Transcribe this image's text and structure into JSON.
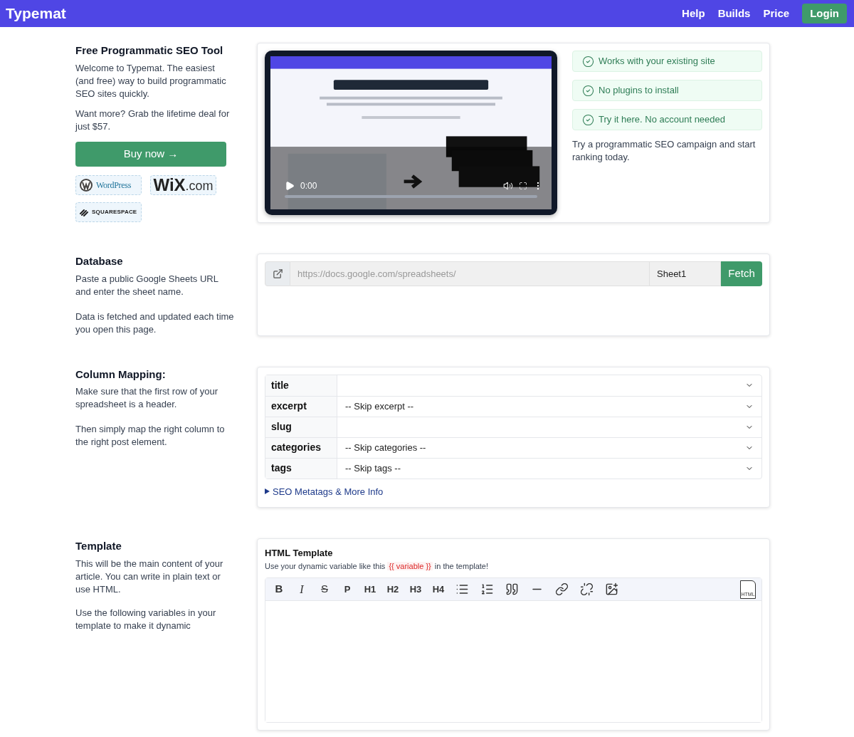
{
  "header": {
    "brand": "Typemat",
    "nav": [
      {
        "label": "Help",
        "kind": "link"
      },
      {
        "label": "Builds",
        "kind": "link"
      },
      {
        "label": "Price",
        "kind": "link"
      },
      {
        "label": "Login",
        "kind": "button"
      }
    ]
  },
  "intro": {
    "title": "Free Programmatic SEO Tool",
    "paragraphs": [
      "Welcome to Typemat. The easiest (and free) way to build programmatic SEO sites quickly.",
      "Want more? Grab the lifetime deal for just $57."
    ],
    "buy_button": "Buy now →",
    "logos": [
      {
        "kind": "wordpress",
        "text": "WordPress"
      },
      {
        "kind": "wix",
        "text": "WiX",
        "suffix": ".com"
      },
      {
        "kind": "squarespace",
        "text": "SQUARESPACE"
      }
    ],
    "video": {
      "kind": "picture",
      "time": "0:00"
    },
    "features": [
      "Works with your existing site",
      "No plugins to install",
      "Try it here. No account needed"
    ],
    "tagline": "Try a programmatic SEO campaign and start ranking today."
  },
  "database": {
    "title": "Database",
    "paragraphs": [
      "Paste a public Google Sheets URL and enter the sheet name.",
      "Data is fetched and updated each time you open this page."
    ],
    "url_placeholder": "https://docs.google.com/spreadsheets/",
    "sheet_value": "Sheet1",
    "fetch_button": "Fetch"
  },
  "mapping": {
    "title": "Column Mapping:",
    "paragraphs": [
      "Make sure that the first row of your spreadsheet is a header.",
      "Then simply map the right column to the right post element."
    ],
    "rows": [
      {
        "label": "title"
      },
      {
        "label": "excerpt",
        "value": "-- Skip excerpt --"
      },
      {
        "label": "slug"
      },
      {
        "label": "categories",
        "value": "-- Skip categories --"
      },
      {
        "label": "tags",
        "value": "-- Skip tags --"
      }
    ],
    "details": {
      "label": "SEO Metatags & More Info",
      "expanded": false
    }
  },
  "template": {
    "title": "Template",
    "paragraphs": [
      "This will be the main content of your article. You can write in plain text or use HTML.",
      "Use the following variables in your template to make it dynamic"
    ],
    "editor_title": "HTML Template",
    "hint_parts": [
      "Use your dynamic variable like this",
      "{{ variable }}",
      "in the template!"
    ],
    "text_buttons": [
      {
        "label": "B",
        "kind": "bold"
      },
      {
        "label": "I",
        "kind": "italic"
      },
      {
        "label": "S",
        "kind": "strike"
      },
      {
        "label": "P",
        "kind": "plain"
      },
      {
        "label": "H1",
        "kind": "plain"
      },
      {
        "label": "H2",
        "kind": "plain"
      },
      {
        "label": "H3",
        "kind": "plain"
      },
      {
        "label": "H4",
        "kind": "plain"
      }
    ],
    "html_toggle": "HTML"
  }
}
